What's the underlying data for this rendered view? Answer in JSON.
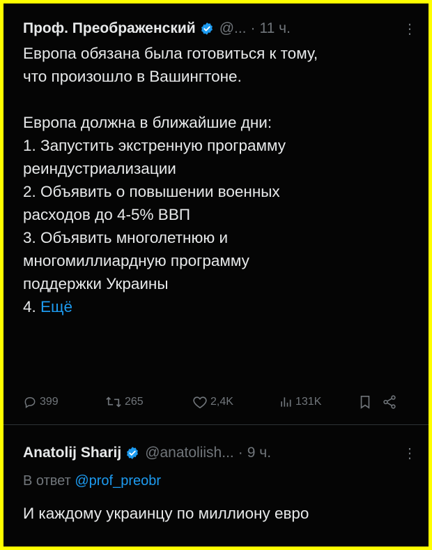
{
  "tweet1": {
    "name": "Проф. Преображенский",
    "handle": "@...",
    "separator": "·",
    "time": "11 ч.",
    "more": "⋮",
    "text": "Европа обязана была готовиться к тому,\nчто произошло в Вашингтоне.\n\nЕвропа должна в ближайшие дни:\n1. Запустить экстренную программу\nреиндустриализации\n2. Объявить о повышении военных\nрасходов до 4-5% ВВП\n3. Объявить многолетнюю и\nмногомиллиардную программу\nподдержки Украины\n4. ",
    "show_more": "Ещё",
    "replies": "399",
    "retweets": "265",
    "likes": "2,4K",
    "views": "131K"
  },
  "tweet2": {
    "name": "Anatolij Sharij",
    "handle": "@anatoliish...",
    "separator": "·",
    "time": "9 ч.",
    "more": "⋮",
    "reply_prefix": "В ответ",
    "reply_handle": "@prof_preobr",
    "text": "И каждому украинцу по миллиону евро"
  },
  "colors": {
    "frame": "#ffff00",
    "background": "#050505",
    "text": "#e7e9ea",
    "muted": "#71767b",
    "accent": "#1d9bf0"
  },
  "icons": [
    "verified-badge-icon",
    "reply-icon",
    "retweet-icon",
    "like-icon",
    "views-icon",
    "bookmark-icon",
    "share-icon",
    "more-icon"
  ]
}
